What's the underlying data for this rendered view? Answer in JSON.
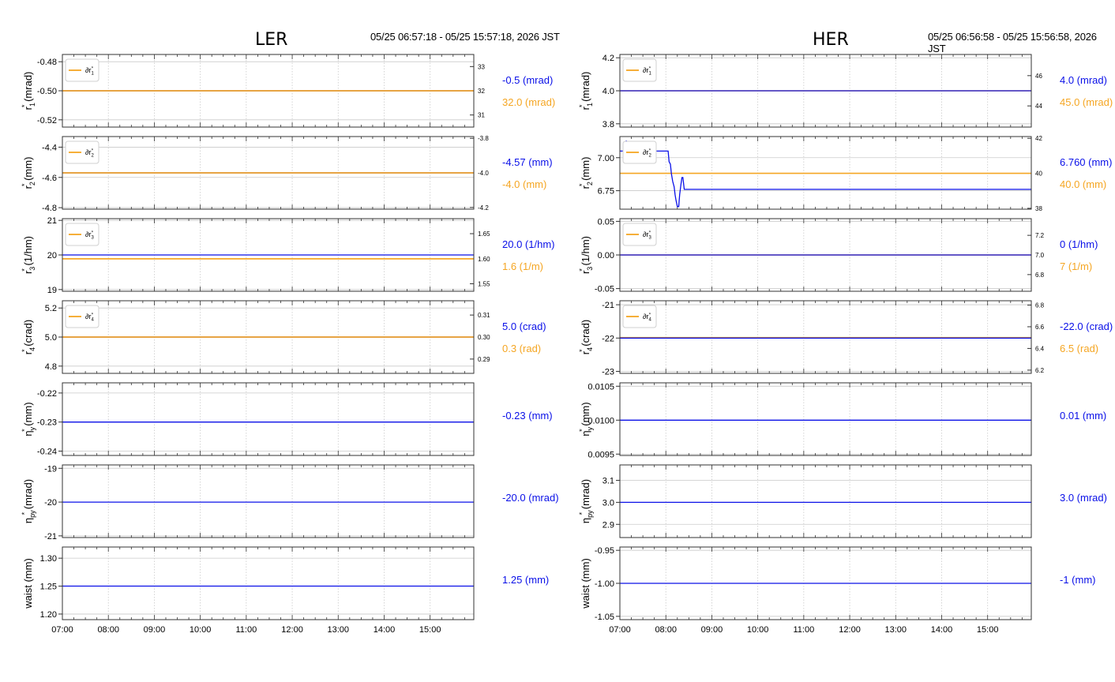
{
  "colors": {
    "primary": "#0a10e8",
    "secondary": "#f5a623",
    "grid": "#c9c9c9",
    "frame": "#333333"
  },
  "icons": [
    "legend-swatch-icon"
  ],
  "panels_layout": [
    {
      "side": "LER",
      "title": "LER",
      "time_range": "05/25 06:57:18 - 05/25 15:57:18, 2026 JST",
      "x_ticks": [
        "07:00",
        "08:00",
        "09:00",
        "10:00",
        "11:00",
        "12:00",
        "13:00",
        "14:00",
        "15:00"
      ]
    },
    {
      "side": "HER",
      "title": "HER",
      "time_range": "05/25 06:56:58 - 05/25 15:56:58, 2026 JST",
      "x_ticks": [
        "07:00",
        "08:00",
        "09:00",
        "10:00",
        "11:00",
        "12:00",
        "13:00",
        "14:00",
        "15:00"
      ]
    }
  ],
  "chart_data": [
    {
      "type": "line",
      "panel": "LER",
      "row": 1,
      "ylabel": "r₁* (mrad)",
      "ylabel_main": "r",
      "ylabel_sub": "1",
      "ylabel_unit": "(mrad)",
      "ylim": [
        -0.525,
        -0.475
      ],
      "yticks": [
        "-0.48",
        "-0.50",
        "-0.52"
      ],
      "ytick_values": [
        -0.48,
        -0.5,
        -0.52
      ],
      "y2lim": [
        30.5,
        33.5
      ],
      "y2ticks": [
        "33",
        "32",
        "31"
      ],
      "y2tick_values": [
        33,
        32,
        31
      ],
      "legend": "∂r₁*",
      "legend_main": "∂r",
      "legend_sub": "1",
      "legend_placement": "top-left",
      "series": [
        {
          "axis": "left",
          "color": "#0a10e8",
          "x": [
            7.0,
            15.95
          ],
          "values": [
            -0.5,
            -0.5
          ]
        },
        {
          "axis": "right",
          "color": "#f5a623",
          "x": [
            7.0,
            15.95
          ],
          "values": [
            32.0,
            32.0
          ]
        }
      ],
      "readout_primary": "-0.5 (mrad)",
      "readout_secondary": "32.0 (mrad)"
    },
    {
      "type": "line",
      "panel": "LER",
      "row": 2,
      "ylabel": "r₂* (mm)",
      "ylabel_main": "r",
      "ylabel_sub": "2",
      "ylabel_unit": "(mm)",
      "ylim": [
        -4.81,
        -4.33
      ],
      "yticks": [
        "-4.4",
        "-4.6",
        "-4.8"
      ],
      "ytick_values": [
        -4.4,
        -4.6,
        -4.8
      ],
      "y2lim": [
        -4.21,
        -3.79
      ],
      "y2ticks": [
        "-3.8",
        "-4.0",
        "-4.2"
      ],
      "y2tick_values": [
        -3.8,
        -4.0,
        -4.2
      ],
      "legend": "∂r₂*",
      "legend_main": "∂r",
      "legend_sub": "2",
      "legend_placement": "top-left",
      "series": [
        {
          "axis": "left",
          "color": "#0a10e8",
          "x": [
            7.0,
            15.95
          ],
          "values": [
            -4.57,
            -4.57
          ]
        },
        {
          "axis": "right",
          "color": "#f5a623",
          "x": [
            7.0,
            15.95
          ],
          "values": [
            -4.0,
            -4.0
          ]
        }
      ],
      "readout_primary": "-4.57 (mm)",
      "readout_secondary": "-4.0 (mm)"
    },
    {
      "type": "line",
      "panel": "LER",
      "row": 3,
      "ylabel": "r₃* (1/hm)",
      "ylabel_main": "r",
      "ylabel_sub": "3",
      "ylabel_unit": "(1/hm)",
      "ylim": [
        18.95,
        21.05
      ],
      "yticks": [
        "21",
        "20",
        "19"
      ],
      "ytick_values": [
        21,
        20,
        19
      ],
      "y2lim": [
        1.535,
        1.68
      ],
      "y2ticks": [
        "1.65",
        "1.60",
        "1.55"
      ],
      "y2tick_values": [
        1.65,
        1.6,
        1.55
      ],
      "legend": "∂r₃*",
      "legend_main": "∂r",
      "legend_sub": "3",
      "legend_placement": "top-left",
      "series": [
        {
          "axis": "left",
          "color": "#0a10e8",
          "x": [
            7.0,
            15.95
          ],
          "values": [
            20.0,
            20.0
          ]
        },
        {
          "axis": "right",
          "color": "#f5a623",
          "x": [
            7.0,
            15.95
          ],
          "values": [
            1.6,
            1.6
          ]
        }
      ],
      "readout_primary": "20.0 (1/hm)",
      "readout_secondary": "1.6 (1/m)"
    },
    {
      "type": "line",
      "panel": "LER",
      "row": 4,
      "ylabel": "r₄* (crad)",
      "ylabel_main": "r",
      "ylabel_sub": "4",
      "ylabel_unit": "(crad)",
      "ylim": [
        4.75,
        5.25
      ],
      "yticks": [
        "5.2",
        "5.0",
        "4.8"
      ],
      "ytick_values": [
        5.2,
        5.0,
        4.8
      ],
      "y2lim": [
        0.2835,
        0.3165
      ],
      "y2ticks": [
        "0.31",
        "0.30",
        "0.29"
      ],
      "y2tick_values": [
        0.31,
        0.3,
        0.29
      ],
      "legend": "∂r₄*",
      "legend_main": "∂r",
      "legend_sub": "4",
      "legend_placement": "top-left",
      "series": [
        {
          "axis": "left",
          "color": "#0a10e8",
          "x": [
            7.0,
            15.95
          ],
          "values": [
            5.0,
            5.0
          ]
        },
        {
          "axis": "right",
          "color": "#f5a623",
          "x": [
            7.0,
            15.95
          ],
          "values": [
            0.3,
            0.3
          ]
        }
      ],
      "readout_primary": "5.0 (crad)",
      "readout_secondary": "0.3 (rad)"
    },
    {
      "type": "line",
      "panel": "LER",
      "row": 5,
      "ylabel": "ηy* (mm)",
      "ylabel_main": "η",
      "ylabel_sub": "y",
      "ylabel_unit": "(mm)",
      "ylim": [
        -0.2415,
        -0.2165
      ],
      "yticks": [
        "-0.22",
        "-0.23",
        "-0.24"
      ],
      "ytick_values": [
        -0.22,
        -0.23,
        -0.24
      ],
      "series": [
        {
          "axis": "left",
          "color": "#0a10e8",
          "x": [
            7.0,
            15.95
          ],
          "values": [
            -0.23,
            -0.23
          ]
        }
      ],
      "readout_primary": "-0.23 (mm)"
    },
    {
      "type": "line",
      "panel": "LER",
      "row": 6,
      "ylabel": "ηpy* (mrad)",
      "ylabel_main": "η",
      "ylabel_sub": "py",
      "ylabel_unit": "(mrad)",
      "ylim": [
        -21.05,
        -18.9
      ],
      "yticks": [
        "-19",
        "-20",
        "-21"
      ],
      "ytick_values": [
        -19,
        -20,
        -21
      ],
      "series": [
        {
          "axis": "left",
          "color": "#0a10e8",
          "x": [
            7.0,
            15.95
          ],
          "values": [
            -20.0,
            -20.0
          ]
        }
      ],
      "readout_primary": "-20.0 (mrad)"
    },
    {
      "type": "line",
      "panel": "LER",
      "row": 7,
      "ylabel": "waist (mm)",
      "ylabel_main": "waist",
      "ylabel_sub": "",
      "ylabel_unit": "(mm)",
      "ylim": [
        1.19,
        1.32
      ],
      "yticks": [
        "1.30",
        "1.25",
        "1.20"
      ],
      "ytick_values": [
        1.3,
        1.25,
        1.2
      ],
      "series": [
        {
          "axis": "left",
          "color": "#0a10e8",
          "x": [
            7.0,
            15.95
          ],
          "values": [
            1.25,
            1.25
          ]
        }
      ],
      "readout_primary": "1.25 (mm)"
    },
    {
      "type": "line",
      "panel": "HER",
      "row": 1,
      "ylabel": "r₁* (mrad)",
      "ylabel_main": "r",
      "ylabel_sub": "1",
      "ylabel_unit": "(mrad)",
      "ylim": [
        3.78,
        4.22
      ],
      "yticks": [
        "4.2",
        "4.0",
        "3.8"
      ],
      "ytick_values": [
        4.2,
        4.0,
        3.8
      ],
      "y2lim": [
        42.6,
        47.4
      ],
      "y2ticks": [
        "46",
        "44"
      ],
      "y2tick_values": [
        46,
        44
      ],
      "legend": "∂r₁*",
      "legend_main": "∂r",
      "legend_sub": "1",
      "legend_placement": "top-left",
      "series": [
        {
          "axis": "left",
          "color": "#0a10e8",
          "x": [
            7.0,
            15.95
          ],
          "values": [
            4.0,
            4.0
          ]
        },
        {
          "axis": "right",
          "color": "#f5a623",
          "x": [
            7.0,
            15.95
          ],
          "values": [
            45.0,
            45.0
          ]
        }
      ],
      "readout_primary": "4.0 (mrad)",
      "readout_secondary": "45.0 (mrad)"
    },
    {
      "type": "line",
      "panel": "HER",
      "row": 2,
      "ylabel": "r₂* (mm)",
      "ylabel_main": "r",
      "ylabel_sub": "2",
      "ylabel_unit": "(mm)",
      "ylim": [
        6.61,
        7.16
      ],
      "yticks": [
        "7.00",
        "6.75"
      ],
      "ytick_values": [
        7.0,
        6.75
      ],
      "y2lim": [
        37.95,
        42.1
      ],
      "y2ticks": [
        "42",
        "40",
        "38"
      ],
      "y2tick_values": [
        42,
        40,
        38
      ],
      "legend": "∂r₂*",
      "legend_main": "∂r",
      "legend_sub": "2",
      "legend_placement": "top-left",
      "series": [
        {
          "axis": "left",
          "color": "#0a10e8",
          "x": [
            7.0,
            7.12,
            7.14,
            7.16,
            7.2,
            8.05,
            8.07,
            8.1,
            8.12,
            8.15,
            8.18,
            8.2,
            8.22,
            8.25,
            8.28,
            8.3,
            8.33,
            8.35,
            8.37,
            8.4,
            8.42,
            15.95
          ],
          "values": [
            7.05,
            7.05,
            7.13,
            7.05,
            7.05,
            7.05,
            6.97,
            6.95,
            6.88,
            6.82,
            6.78,
            6.72,
            6.68,
            6.63,
            6.63,
            6.72,
            6.8,
            6.85,
            6.85,
            6.76,
            6.76,
            6.76
          ]
        },
        {
          "axis": "right",
          "color": "#f5a623",
          "x": [
            7.0,
            15.95
          ],
          "values": [
            40.0,
            40.0
          ]
        }
      ],
      "readout_primary": "6.760 (mm)",
      "readout_secondary": "40.0 (mm)"
    },
    {
      "type": "line",
      "panel": "HER",
      "row": 3,
      "ylabel": "r₃* (1/hm)",
      "ylabel_main": "r",
      "ylabel_sub": "3",
      "ylabel_unit": "(1/hm)",
      "ylim": [
        -0.054,
        0.054
      ],
      "yticks": [
        "0.05",
        "0.00",
        "-0.05"
      ],
      "ytick_values": [
        0.05,
        0.0,
        -0.05
      ],
      "y2lim": [
        6.63,
        7.37
      ],
      "y2ticks": [
        "7.2",
        "7.0",
        "6.8"
      ],
      "y2tick_values": [
        7.2,
        7.0,
        6.8
      ],
      "legend": "∂r₃*",
      "legend_main": "∂r",
      "legend_sub": "3",
      "legend_placement": "top-left",
      "series": [
        {
          "axis": "left",
          "color": "#0a10e8",
          "x": [
            7.0,
            15.95
          ],
          "values": [
            0.0,
            0.0
          ]
        },
        {
          "axis": "right",
          "color": "#f5a623",
          "x": [
            7.0,
            15.95
          ],
          "values": [
            7.0,
            7.0
          ]
        }
      ],
      "readout_primary": "0 (1/hm)",
      "readout_secondary": "7 (1/m)"
    },
    {
      "type": "line",
      "panel": "HER",
      "row": 4,
      "ylabel": "r₄* (crad)",
      "ylabel_main": "r",
      "ylabel_sub": "4",
      "ylabel_unit": "(crad)",
      "ylim": [
        -23.06,
        -20.88
      ],
      "yticks": [
        "-21",
        "-22",
        "-23"
      ],
      "ytick_values": [
        -21,
        -22,
        -23
      ],
      "y2lim": [
        6.17,
        6.84
      ],
      "y2ticks": [
        "6.8",
        "6.6",
        "6.4",
        "6.2"
      ],
      "y2tick_values": [
        6.8,
        6.6,
        6.4,
        6.2
      ],
      "legend": "∂r₄*",
      "legend_main": "∂r",
      "legend_sub": "4",
      "legend_placement": "top-left",
      "series": [
        {
          "axis": "left",
          "color": "#0a10e8",
          "x": [
            7.0,
            15.95
          ],
          "values": [
            -22.0,
            -22.0
          ]
        },
        {
          "axis": "right",
          "color": "#f5a623",
          "x": [
            7.0,
            15.95
          ],
          "values": [
            6.5,
            6.5
          ]
        }
      ],
      "readout_primary": "-22.0 (crad)",
      "readout_secondary": "6.5 (rad)"
    },
    {
      "type": "line",
      "panel": "HER",
      "row": 5,
      "ylabel": "ηy* (mm)",
      "ylabel_main": "η",
      "ylabel_sub": "y",
      "ylabel_unit": "(mm)",
      "ylim": [
        0.00948,
        0.01055
      ],
      "yticks": [
        "0.0105",
        "0.0100",
        "0.0095"
      ],
      "ytick_values": [
        0.0105,
        0.01,
        0.0095
      ],
      "series": [
        {
          "axis": "left",
          "color": "#0a10e8",
          "x": [
            7.0,
            15.95
          ],
          "values": [
            0.01,
            0.01
          ]
        }
      ],
      "readout_primary": "0.01 (mm)"
    },
    {
      "type": "line",
      "panel": "HER",
      "row": 6,
      "ylabel": "ηpy* (mrad)",
      "ylabel_main": "η",
      "ylabel_sub": "py",
      "ylabel_unit": "(mrad)",
      "ylim": [
        2.84,
        3.17
      ],
      "yticks": [
        "3.1",
        "3.0",
        "2.9"
      ],
      "ytick_values": [
        3.1,
        3.0,
        2.9
      ],
      "series": [
        {
          "axis": "left",
          "color": "#0a10e8",
          "x": [
            7.0,
            15.95
          ],
          "values": [
            3.0,
            3.0
          ]
        }
      ],
      "readout_primary": "3.0 (mrad)"
    },
    {
      "type": "line",
      "panel": "HER",
      "row": 7,
      "ylabel": "waist (mm)",
      "ylabel_main": "waist",
      "ylabel_sub": "",
      "ylabel_unit": "(mm)",
      "ylim": [
        -1.055,
        -0.945
      ],
      "yticks": [
        "-0.95",
        "-1.00",
        "-1.05"
      ],
      "ytick_values": [
        -0.95,
        -1.0,
        -1.05
      ],
      "series": [
        {
          "axis": "left",
          "color": "#0a10e8",
          "x": [
            7.0,
            15.95
          ],
          "values": [
            -1.0,
            -1.0
          ]
        }
      ],
      "readout_primary": "-1 (mm)"
    }
  ]
}
